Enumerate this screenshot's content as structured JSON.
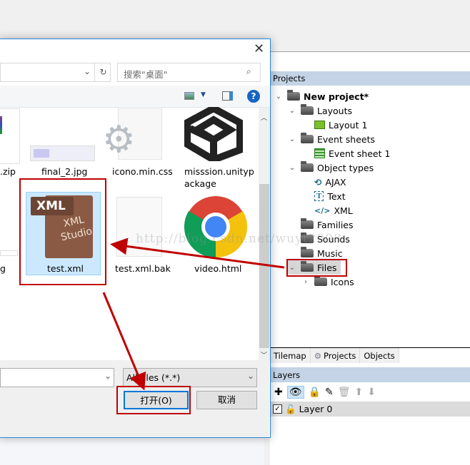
{
  "dialog": {
    "search_placeholder": "搜索\"桌面\"",
    "files": [
      {
        "name": ".zip"
      },
      {
        "name": "final_2.jpg"
      },
      {
        "name": "icono.min.css"
      },
      {
        "name": "misssion.unitypackage",
        "line1": "misssion.unityp",
        "line2": "ackage"
      },
      {
        "name": "g"
      },
      {
        "name": "test.xml",
        "selected": true,
        "icon_text1": "XML",
        "icon_text2": "XML",
        "icon_text3": "Studio"
      },
      {
        "name": "test.xml.bak"
      },
      {
        "name": "video.html"
      }
    ],
    "filter_value": "All files (*.*)",
    "open_label": "打开(O)",
    "cancel_label": "取消"
  },
  "projects": {
    "title": "Projects",
    "tree": [
      {
        "label": "New project*",
        "level": 0,
        "icon": "folder-icon",
        "expanded": true
      },
      {
        "label": "Layouts",
        "level": 1,
        "icon": "folder-icon",
        "expanded": true
      },
      {
        "label": "Layout 1",
        "level": 2,
        "icon": "layout-icon"
      },
      {
        "label": "Event sheets",
        "level": 1,
        "icon": "folder-icon",
        "expanded": true
      },
      {
        "label": "Event sheet 1",
        "level": 2,
        "icon": "event-sheet-icon"
      },
      {
        "label": "Object types",
        "level": 1,
        "icon": "folder-icon",
        "expanded": true
      },
      {
        "label": "AJAX",
        "level": 2,
        "icon": "ajax-icon"
      },
      {
        "label": "Text",
        "level": 2,
        "icon": "text-icon"
      },
      {
        "label": "XML",
        "level": 2,
        "icon": "xml-icon"
      },
      {
        "label": "Families",
        "level": 1,
        "icon": "folder-icon"
      },
      {
        "label": "Sounds",
        "level": 1,
        "icon": "folder-icon"
      },
      {
        "label": "Music",
        "level": 1,
        "icon": "folder-icon"
      },
      {
        "label": "Files",
        "level": 1,
        "icon": "folder-icon",
        "expanded": true,
        "selected": true
      },
      {
        "label": "Icons",
        "level": 2,
        "icon": "folder-icon",
        "collapsed": true
      }
    ],
    "tabs": [
      "Tilemap",
      "Projects",
      "Objects"
    ]
  },
  "layers": {
    "title": "Layers",
    "rows": [
      {
        "label": "Layer 0",
        "checked": true
      }
    ]
  },
  "watermark": "http://blog.csdn.net/wuyt2008",
  "colors": {
    "annotation": "#c00000",
    "accent": "#0078d7",
    "panel_header": "#c4d4e6"
  }
}
